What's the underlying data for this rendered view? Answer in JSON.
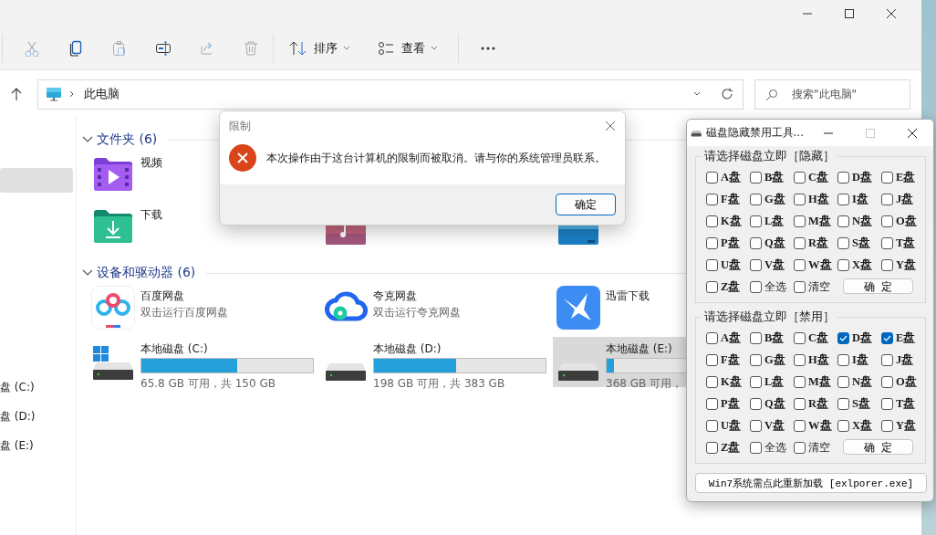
{
  "toolbar": {
    "sort_label": "排序",
    "view_label": "查看"
  },
  "address_bar": {
    "path": "此电脑"
  },
  "search": {
    "placeholder": "搜索\"此电脑\""
  },
  "nav_pane": {
    "items": [
      {
        "selected": true
      },
      {
        "label": "盘 (C:)",
        "selected": false
      },
      {
        "label": "盘 (D:)",
        "selected": false
      },
      {
        "label": "盘 (E:)",
        "selected": false
      }
    ]
  },
  "sections": [
    {
      "title": "文件夹 (6)",
      "expanded": true,
      "items": [
        {
          "kind": "videos",
          "name": "视频"
        },
        {
          "kind": "hidden"
        },
        {
          "kind": "hidden"
        },
        {
          "kind": "downloads",
          "name": "下载"
        },
        {
          "kind": "music"
        },
        {
          "kind": "desktop"
        }
      ]
    },
    {
      "title": "设备和驱动器 (6)",
      "expanded": true,
      "items": [
        {
          "kind": "rings",
          "name": "百度网盘",
          "subtitle": "双击运行百度网盘"
        },
        {
          "kind": "cloud",
          "name": "夸克网盘",
          "subtitle": "双击运行夸克网盘"
        },
        {
          "kind": "bird",
          "name": "迅雷下载"
        },
        {
          "kind": "drive",
          "system": true,
          "name": "本地磁盘 (C:)",
          "level": 0.56,
          "free": "65.8 GB 可用，共 150 GB",
          "selected": false
        },
        {
          "kind": "drive",
          "system": false,
          "name": "本地磁盘 (D:)",
          "level": 0.48,
          "free": "198 GB 可用，共 383 GB",
          "selected": false
        },
        {
          "kind": "drive",
          "system": false,
          "name": "本地磁盘 (E:)",
          "level": 0.04,
          "free": "368 GB 可用，",
          "selected": true
        }
      ]
    }
  ],
  "dialog": {
    "title": "限制",
    "message": "本次操作由于这台计算机的限制而被取消。请与你的系统管理员联系。",
    "button": "确定"
  },
  "tool_window": {
    "title": "磁盘隐藏禁用工具...",
    "groups": [
      {
        "title": "请选择磁盘立即［隐藏］",
        "button": "确  定",
        "checkboxes": [
          {
            "label": "A盘",
            "checked": false
          },
          {
            "label": "B盘",
            "checked": false
          },
          {
            "label": "C盘",
            "checked": false
          },
          {
            "label": "D盘",
            "checked": false
          },
          {
            "label": "E盘",
            "checked": false
          },
          {
            "label": "F盘",
            "checked": false
          },
          {
            "label": "G盘",
            "checked": false
          },
          {
            "label": "H盘",
            "checked": false
          },
          {
            "label": "I盘",
            "checked": false
          },
          {
            "label": "J盘",
            "checked": false
          },
          {
            "label": "K盘",
            "checked": false
          },
          {
            "label": "L盘",
            "checked": false
          },
          {
            "label": "M盘",
            "checked": false
          },
          {
            "label": "N盘",
            "checked": false
          },
          {
            "label": "O盘",
            "checked": false
          },
          {
            "label": "P盘",
            "checked": false
          },
          {
            "label": "Q盘",
            "checked": false
          },
          {
            "label": "R盘",
            "checked": false
          },
          {
            "label": "S盘",
            "checked": false
          },
          {
            "label": "T盘",
            "checked": false
          },
          {
            "label": "U盘",
            "checked": false
          },
          {
            "label": "V盘",
            "checked": false
          },
          {
            "label": "W盘",
            "checked": false
          },
          {
            "label": "X盘",
            "checked": false
          },
          {
            "label": "Y盘",
            "checked": false
          },
          {
            "label": "Z盘",
            "checked": false
          },
          {
            "label": "全选",
            "checked": false
          },
          {
            "label": "清空",
            "checked": false
          }
        ]
      },
      {
        "title": "请选择磁盘立即［禁用］",
        "button": "确  定",
        "checkboxes": [
          {
            "label": "A盘",
            "checked": false
          },
          {
            "label": "B盘",
            "checked": false
          },
          {
            "label": "C盘",
            "checked": false
          },
          {
            "label": "D盘",
            "checked": true
          },
          {
            "label": "E盘",
            "checked": true
          },
          {
            "label": "F盘",
            "checked": false
          },
          {
            "label": "G盘",
            "checked": false
          },
          {
            "label": "H盘",
            "checked": false
          },
          {
            "label": "I盘",
            "checked": false
          },
          {
            "label": "J盘",
            "checked": false
          },
          {
            "label": "K盘",
            "checked": false
          },
          {
            "label": "L盘",
            "checked": false
          },
          {
            "label": "M盘",
            "checked": false
          },
          {
            "label": "N盘",
            "checked": false
          },
          {
            "label": "O盘",
            "checked": false
          },
          {
            "label": "P盘",
            "checked": false
          },
          {
            "label": "Q盘",
            "checked": false
          },
          {
            "label": "R盘",
            "checked": false
          },
          {
            "label": "S盘",
            "checked": false
          },
          {
            "label": "T盘",
            "checked": false
          },
          {
            "label": "U盘",
            "checked": false
          },
          {
            "label": "V盘",
            "checked": false
          },
          {
            "label": "W盘",
            "checked": false
          },
          {
            "label": "X盘",
            "checked": false
          },
          {
            "label": "Y盘",
            "checked": false
          },
          {
            "label": "Z盘",
            "checked": false
          },
          {
            "label": "全选",
            "checked": false
          },
          {
            "label": "清空",
            "checked": false
          }
        ]
      }
    ],
    "reload_button": "Win7系统需点此重新加载 [exlporer.exe]"
  }
}
